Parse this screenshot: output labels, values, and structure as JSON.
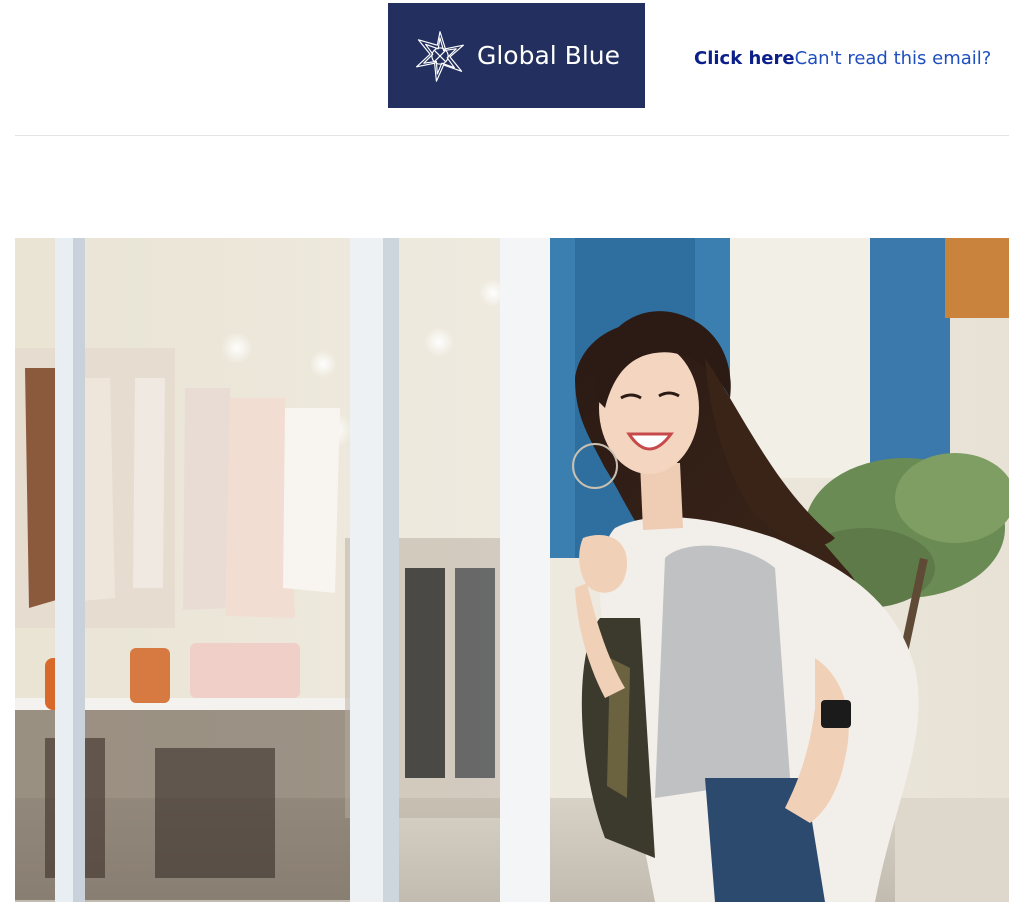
{
  "header": {
    "logo": {
      "icon": "global-blue-star-icon",
      "text": "Global Blue",
      "background": "#23305f"
    },
    "view_online": {
      "link_label": "Click here",
      "prompt": "Can't read this email?"
    }
  },
  "hero": {
    "image": "woman-shopping-photo",
    "description_icon": "photo"
  },
  "colors": {
    "brand_navy": "#23305f",
    "link_dark": "#0b1f8a",
    "link_blue": "#1f4fbf",
    "divider": "#e4e4e4"
  }
}
